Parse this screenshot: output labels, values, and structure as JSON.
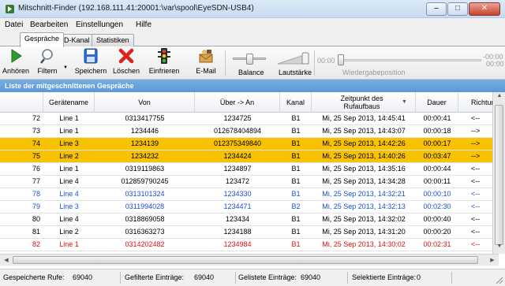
{
  "window": {
    "title": "Mitschnitt-Finder (192.168.111.41:20001:\\var\\spool\\EyeSDN-USB4)"
  },
  "menu": [
    "Datei",
    "Bearbeiten",
    "Einstellungen",
    "Hilfe"
  ],
  "tabs": [
    {
      "label": "Gespräche",
      "active": true
    },
    {
      "label": "D-Kanal",
      "active": false
    },
    {
      "label": "Statistiken",
      "active": false
    }
  ],
  "toolbar": {
    "play": "Anhören",
    "filter": "Filtern",
    "save": "Speichern",
    "delete": "Löschen",
    "freeze": "Einfrieren",
    "email": "E-Mail",
    "balance": "Balance",
    "volume": "Lautstärke",
    "time_start": "00:00",
    "time_end_top": "-00:00",
    "time_end_bottom": "00:00",
    "playback": "Wiedergabeposition"
  },
  "list": {
    "title": "Liste der mitgeschnittenen Gespräche",
    "columns": [
      "Gerätename",
      "Von",
      "Über -> An",
      "Kanal",
      "Zeitpunkt des Rufaufbaus",
      "Dauer",
      "Richtung"
    ],
    "rows": [
      {
        "num": "72",
        "device": "Line 1",
        "from": "0313417755",
        "to": "1234725",
        "channel": "B1",
        "time": "Mi, 25 Sep 2013, 14:45:41",
        "duration": "00:00:41",
        "dir": "<--",
        "style": "normal"
      },
      {
        "num": "73",
        "device": "Line 1",
        "from": "1234446",
        "to": "012678404894",
        "channel": "B1",
        "time": "Mi, 25 Sep 2013, 14:43:07",
        "duration": "00:00:18",
        "dir": "-->",
        "style": "normal"
      },
      {
        "num": "74",
        "device": "Line 3",
        "from": "1234139",
        "to": "012375349840",
        "channel": "B1",
        "time": "Mi, 25 Sep 2013, 14:42:26",
        "duration": "00:00:17",
        "dir": "-->",
        "style": "sel"
      },
      {
        "num": "75",
        "device": "Line 2",
        "from": "1234232",
        "to": "1234424",
        "channel": "B1",
        "time": "Mi, 25 Sep 2013, 14:40:26",
        "duration": "00:03:47",
        "dir": "-->",
        "style": "sel"
      },
      {
        "num": "76",
        "device": "Line 1",
        "from": "0319119863",
        "to": "1234897",
        "channel": "B1",
        "time": "Mi, 25 Sep 2013, 14:35:16",
        "duration": "00:00:44",
        "dir": "<--",
        "style": "normal"
      },
      {
        "num": "77",
        "device": "Line 4",
        "from": "012859790245",
        "to": "123472",
        "channel": "B1",
        "time": "Mi, 25 Sep 2013, 14:34:28",
        "duration": "00:00:11",
        "dir": "<--",
        "style": "normal"
      },
      {
        "num": "78",
        "device": "Line 4",
        "from": "0313101324",
        "to": "1234330",
        "channel": "B1",
        "time": "Mi, 25 Sep 2013, 14:32:21",
        "duration": "00:00:10",
        "dir": "<--",
        "style": "blue"
      },
      {
        "num": "79",
        "device": "Line 3",
        "from": "0311994028",
        "to": "1234471",
        "channel": "B2",
        "time": "Mi, 25 Sep 2013, 14:32:13",
        "duration": "00:02:30",
        "dir": "<--",
        "style": "blue"
      },
      {
        "num": "80",
        "device": "Line 4",
        "from": "0318869058",
        "to": "123434",
        "channel": "B1",
        "time": "Mi, 25 Sep 2013, 14:32:02",
        "duration": "00:00:40",
        "dir": "<--",
        "style": "normal"
      },
      {
        "num": "81",
        "device": "Line 2",
        "from": "0316363273",
        "to": "1234188",
        "channel": "B1",
        "time": "Mi, 25 Sep 2013, 14:31:20",
        "duration": "00:00:20",
        "dir": "<--",
        "style": "normal"
      },
      {
        "num": "82",
        "device": "Line 1",
        "from": "0314202482",
        "to": "1234984",
        "channel": "B1",
        "time": "Mi, 25 Sep 2013, 14:30:02",
        "duration": "00:02:31",
        "dir": "<--",
        "style": "red"
      }
    ]
  },
  "status": {
    "saved_label": "Gespeicherte Rufe:",
    "saved": "69040",
    "filtered_label": "Gefilterte Einträge:",
    "filtered": "69040",
    "listed_label": "Gelistete Einträge:",
    "listed": "69040",
    "selected_label": "Selektierte Einträge:",
    "selected": "0"
  },
  "colors": {
    "selection": "#f8c200",
    "header": "#5a98d6",
    "blue_text": "#1a4fd6",
    "red_text": "#e01010"
  }
}
